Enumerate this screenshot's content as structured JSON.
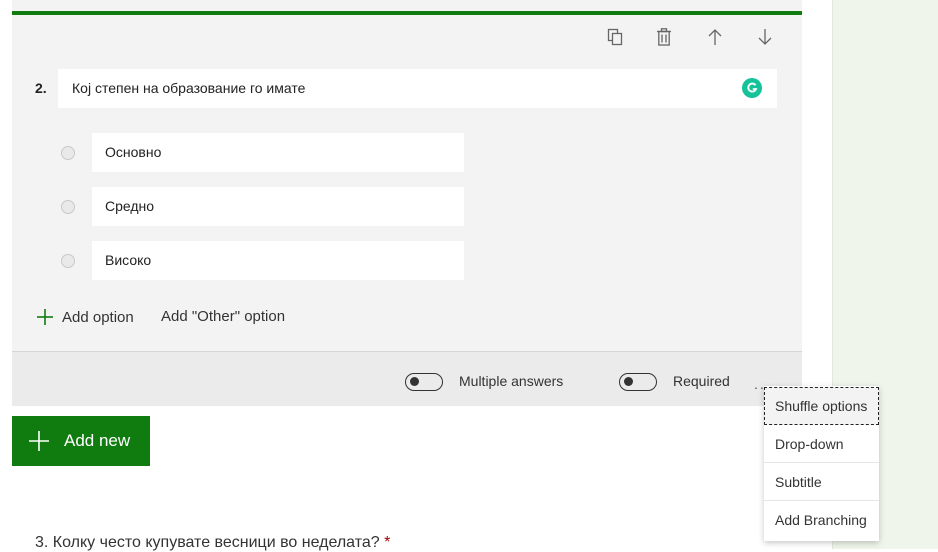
{
  "question": {
    "number": "2.",
    "title": "Кој степен на образование го имате",
    "options": [
      "Основно",
      "Средно",
      "Високо"
    ]
  },
  "toolbar": {
    "icons": [
      "copy-icon",
      "delete-icon",
      "move-up-icon",
      "move-down-icon"
    ]
  },
  "actions": {
    "add_option": "Add option",
    "add_other": "Add \"Other\" option"
  },
  "footer": {
    "multiple_answers": "Multiple answers",
    "multiple_answers_on": false,
    "required": "Required",
    "required_on": false,
    "more": "..."
  },
  "add_new": "Add new",
  "next_question": {
    "text": "3. Колку често купувате весници во неделата?",
    "required_mark": "*"
  },
  "menu": {
    "items": [
      "Shuffle options",
      "Drop-down",
      "Subtitle",
      "Add Branching"
    ]
  },
  "colors": {
    "accent": "#107c10",
    "required": "#a80000",
    "grammarly": "#15c39a",
    "side_panel": "#eff5ea"
  }
}
